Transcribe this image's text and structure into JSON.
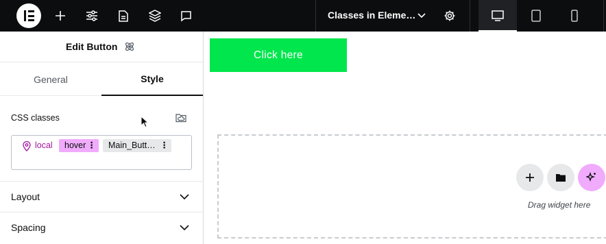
{
  "topbar": {
    "logo_icon": "elementor-logo-icon",
    "tools": [
      "plus-icon",
      "sliders-icon",
      "page-icon",
      "layers-icon",
      "comment-icon"
    ],
    "document_title": "Classes in Eleme…",
    "settings_icon": "gear-icon",
    "devices": [
      "desktop-icon",
      "tablet-icon",
      "mobile-icon"
    ],
    "active_device": "desktop"
  },
  "panel": {
    "title": "Edit Button",
    "tabs": [
      {
        "label": "General",
        "active": false
      },
      {
        "label": "Style",
        "active": true
      }
    ],
    "css_classes": {
      "label": "CSS classes",
      "local_label": "local",
      "chips": [
        {
          "label": "hover",
          "color": "#f0abfc"
        },
        {
          "label": "Main_Butt…",
          "color": "#e6e8ea"
        }
      ]
    },
    "sections": [
      "Layout",
      "Spacing"
    ]
  },
  "canvas": {
    "button_label": "Click here",
    "button_color": "#00e64c",
    "drag_hint": "Drag widget here"
  },
  "colors": {
    "topbar_bg": "#0c0d0e",
    "accent_pink": "#f0abfc",
    "local_text": "#a3159e"
  }
}
